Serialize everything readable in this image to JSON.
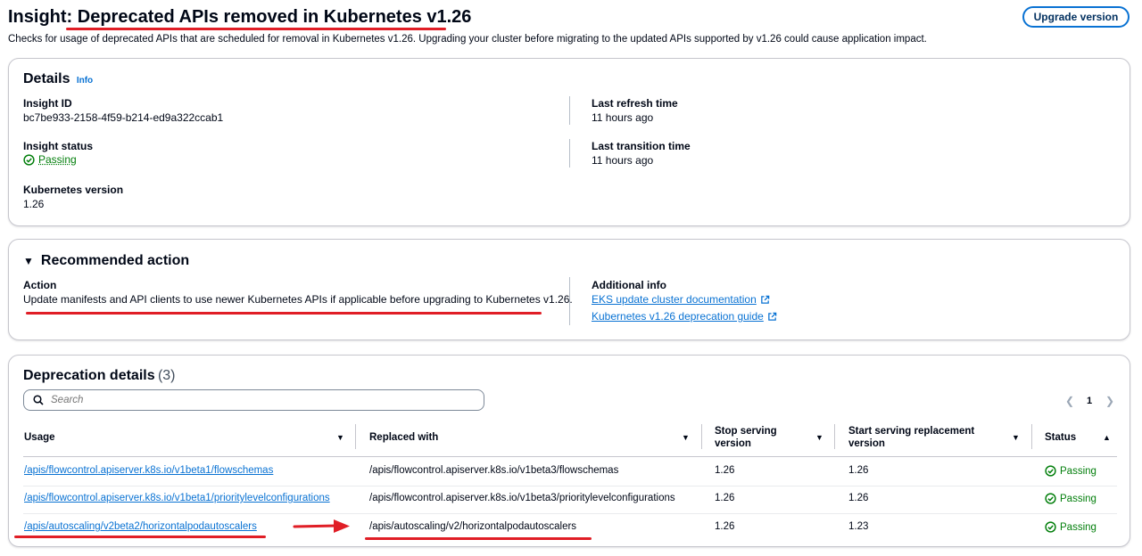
{
  "header": {
    "title_prefix": "Insight: ",
    "title_main": "Deprecated APIs removed in Kubernetes v1.26",
    "description": "Checks for usage of deprecated APIs that are scheduled for removal in Kubernetes v1.26. Upgrading your cluster before migrating to the updated APIs supported by v1.26 could cause application impact.",
    "upgrade_button": "Upgrade version"
  },
  "details": {
    "heading": "Details",
    "info": "Info",
    "insight_id_label": "Insight ID",
    "insight_id": "bc7be933-2158-4f59-b214-ed9a322ccab1",
    "status_label": "Insight status",
    "status": "Passing",
    "k8s_version_label": "Kubernetes version",
    "k8s_version": "1.26",
    "last_refresh_label": "Last refresh time",
    "last_refresh": "11 hours ago",
    "last_transition_label": "Last transition time",
    "last_transition": "11 hours ago"
  },
  "recommended": {
    "heading": "Recommended action",
    "action_label": "Action",
    "action": "Update manifests and API clients to use newer Kubernetes APIs if applicable before upgrading to Kubernetes v1.26.",
    "additional_label": "Additional info",
    "link1": "EKS update cluster documentation",
    "link2": "Kubernetes v1.26 deprecation guide"
  },
  "deprecation": {
    "heading": "Deprecation details",
    "count": "(3)",
    "search_placeholder": "Search",
    "page": "1",
    "columns": {
      "usage": "Usage",
      "replaced": "Replaced with",
      "stop_l1": "Stop serving",
      "stop_l2": "version",
      "start_l1": "Start serving replacement",
      "start_l2": "version",
      "status": "Status"
    },
    "rows": [
      {
        "usage": "/apis/flowcontrol.apiserver.k8s.io/v1beta1/flowschemas",
        "replaced": "/apis/flowcontrol.apiserver.k8s.io/v1beta3/flowschemas",
        "stop": "1.26",
        "start": "1.26",
        "status": "Passing"
      },
      {
        "usage": "/apis/flowcontrol.apiserver.k8s.io/v1beta1/prioritylevelconfigurations",
        "replaced": "/apis/flowcontrol.apiserver.k8s.io/v1beta3/prioritylevelconfigurations",
        "stop": "1.26",
        "start": "1.26",
        "status": "Passing"
      },
      {
        "usage": "/apis/autoscaling/v2beta2/horizontalpodautoscalers",
        "replaced": "/apis/autoscaling/v2/horizontalpodautoscalers",
        "stop": "1.26",
        "start": "1.23",
        "status": "Passing"
      }
    ]
  },
  "colors": {
    "link": "#0972d3",
    "success": "#037f0c",
    "annotation_red": "#e01e26",
    "border": "#c6c6cd"
  }
}
